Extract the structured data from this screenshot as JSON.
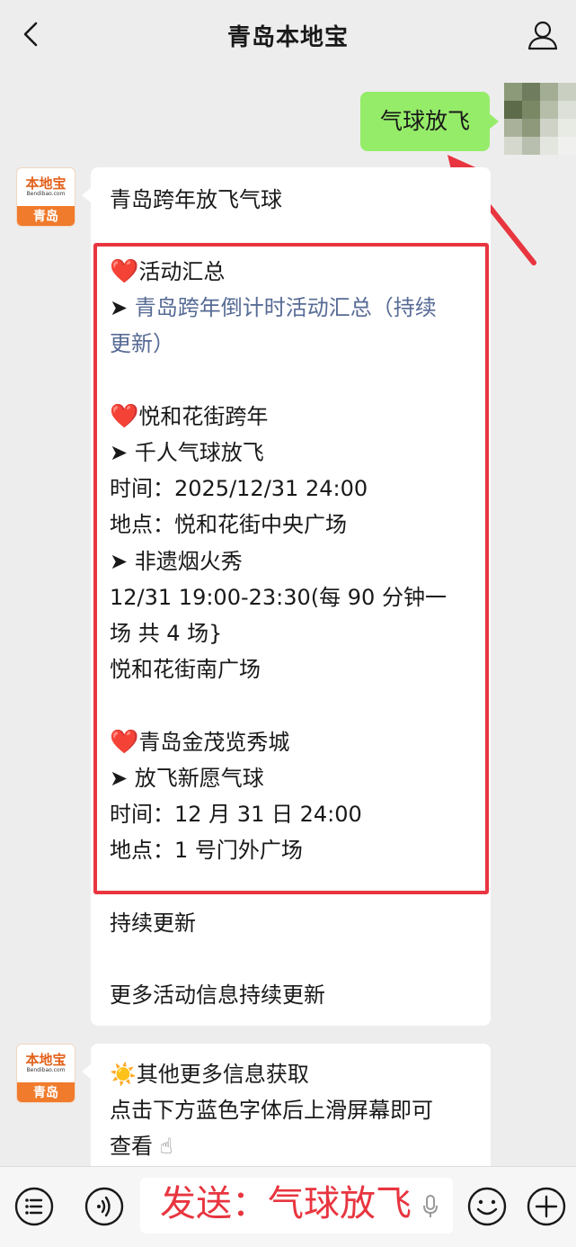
{
  "header": {
    "title": "青岛本地宝",
    "back_icon": "chevron-left-icon",
    "profile_icon": "person-icon"
  },
  "sent_message": {
    "text": "气球放飞",
    "bubble_color": "#95ec69"
  },
  "bot": {
    "avatar_logo": "本地宝",
    "avatar_domain": "Bendibao.com",
    "avatar_city": "青岛"
  },
  "message1": {
    "heading": "青岛跨年放飞气球",
    "section1": {
      "title": "活动汇总",
      "link_line1": "青岛跨年倒计时活动汇总（持续",
      "link_line2": "更新）"
    },
    "section2": {
      "title": "悦和花街跨年",
      "item1_title": "千人气球放飞",
      "item1_time": "时间：2025/12/31 24:00",
      "item1_place": "地点：悦和花街中央广场",
      "item2_title": "非遗烟火秀",
      "item2_line1": "12/31 19:00-23:30(每 90 分钟一",
      "item2_line2": "场 共 4 场}",
      "item2_place": "悦和花街南广场"
    },
    "section3": {
      "title": "青岛金茂览秀城",
      "item1_title": "放飞新愿气球",
      "item1_time": "时间：12 月 31 日 24:00",
      "item1_place": "地点：1 号门外广场"
    },
    "footer1": "持续更新",
    "footer2": "更多活动信息持续更新",
    "heart": "❤️",
    "arrow": "➤"
  },
  "message2": {
    "sun": "☀️",
    "line1": "其他更多信息获取",
    "line2": "点击下方蓝色字体后上滑屏幕即可",
    "line3": "查看",
    "pointer": "☝"
  },
  "bottom_bar": {
    "overlay_text": "发送：气球放飞",
    "accent_color": "#e8353f"
  }
}
